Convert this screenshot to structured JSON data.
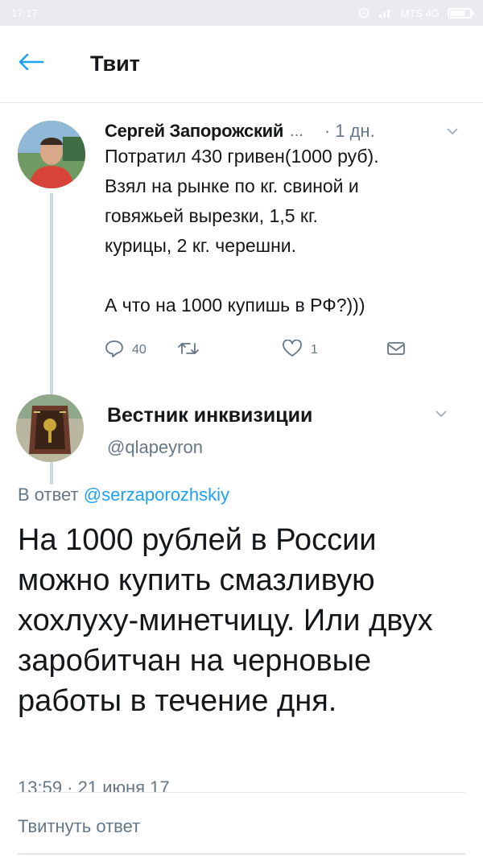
{
  "status_bar": {
    "time": "17:17",
    "carrier": "MTS 4G"
  },
  "header": {
    "title": "Твит"
  },
  "tweet1": {
    "author_name": "Сергей Запорожский",
    "ellipsis": "...",
    "time": "· 1 дн.",
    "text": "Потратил 430 гривен(1000 руб).\nВзял на рынке по кг. свиной и\nговяжьей вырезки, 1,5 кг.\nкурицы, 2 кг. черешни.\n\nА что на 1000 купишь в РФ?)))",
    "replies": "40",
    "likes": "1"
  },
  "tweet2": {
    "author_name": "Вестник инквизиции",
    "handle": "@qlapeyron",
    "reply_prefix": "В ответ",
    "reply_mention": "@serzaporozhskiy",
    "text": "На 1000 рублей в России можно купить смазливую хохлуху-минетчицу. Или двух заробитчан на черновые работы в течение дня.",
    "meta": "13:59 · 21 июня 17"
  },
  "reply_box": {
    "placeholder": "Твитнуть ответ"
  },
  "icons": {
    "back": "arrow-left-icon",
    "caret": "chevron-down-icon",
    "reply": "reply-icon",
    "retweet": "retweet-icon",
    "like": "heart-icon",
    "dm": "envelope-icon"
  },
  "colors": {
    "accent": "#1da1f2",
    "secondary_text": "#657786",
    "primary_text": "#14171a"
  }
}
